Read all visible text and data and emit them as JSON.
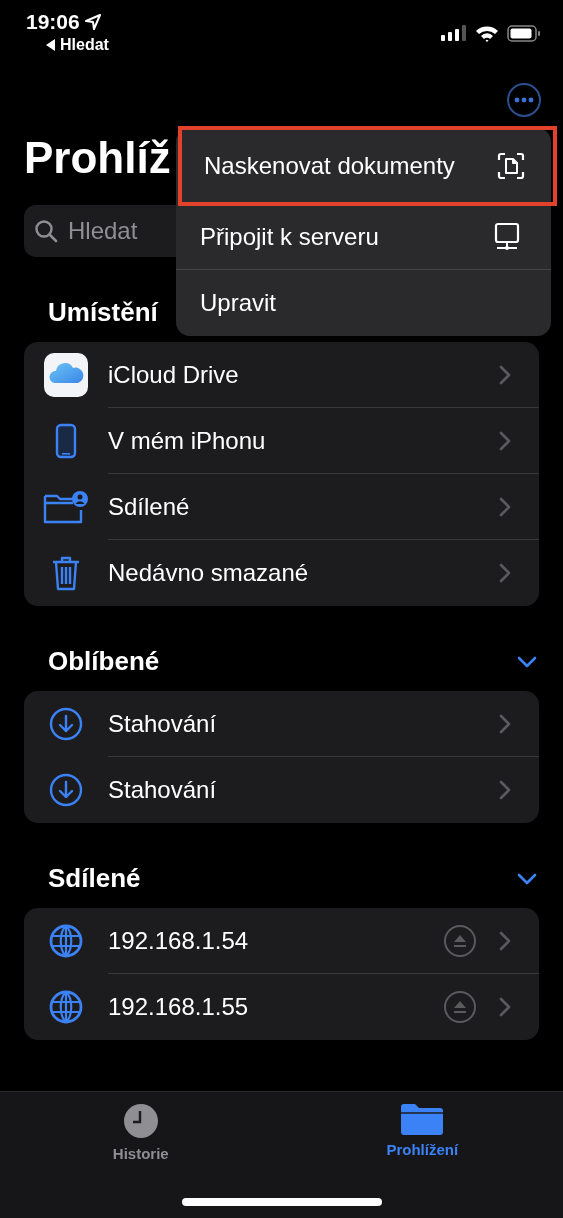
{
  "status_bar": {
    "time": "19:06",
    "back": "Hledat"
  },
  "title": "Prohlíž",
  "search": {
    "placeholder": "Hledat"
  },
  "menu": [
    {
      "label": "Naskenovat dokumenty",
      "kind": "scan",
      "highlighted": true
    },
    {
      "label": "Připojit k serveru",
      "kind": "server",
      "highlighted": false
    },
    {
      "label": "Upravit",
      "highlighted": false
    }
  ],
  "sections": [
    {
      "title": "Umístění",
      "items": [
        {
          "label": "iCloud Drive",
          "kind": "icloud"
        },
        {
          "label": "V mém iPhonu",
          "kind": "phone"
        },
        {
          "label": "Sdílené",
          "kind": "shared"
        },
        {
          "label": "Nedávno smazané",
          "kind": "trash"
        }
      ]
    },
    {
      "title": "Oblíbené",
      "expanded": true,
      "items": [
        {
          "label": "Stahování",
          "kind": "download"
        },
        {
          "label": "Stahování",
          "kind": "download"
        }
      ]
    },
    {
      "title": "Sdílené",
      "expanded": true,
      "items": [
        {
          "label": "192.168.1.54",
          "kind": "globe",
          "eject": true
        },
        {
          "label": "192.168.1.55",
          "kind": "globe",
          "eject": true
        }
      ]
    }
  ],
  "tabs": [
    {
      "label": "Historie",
      "kind": "history",
      "selected": false
    },
    {
      "label": "Prohlížení",
      "kind": "browse",
      "selected": true
    }
  ]
}
